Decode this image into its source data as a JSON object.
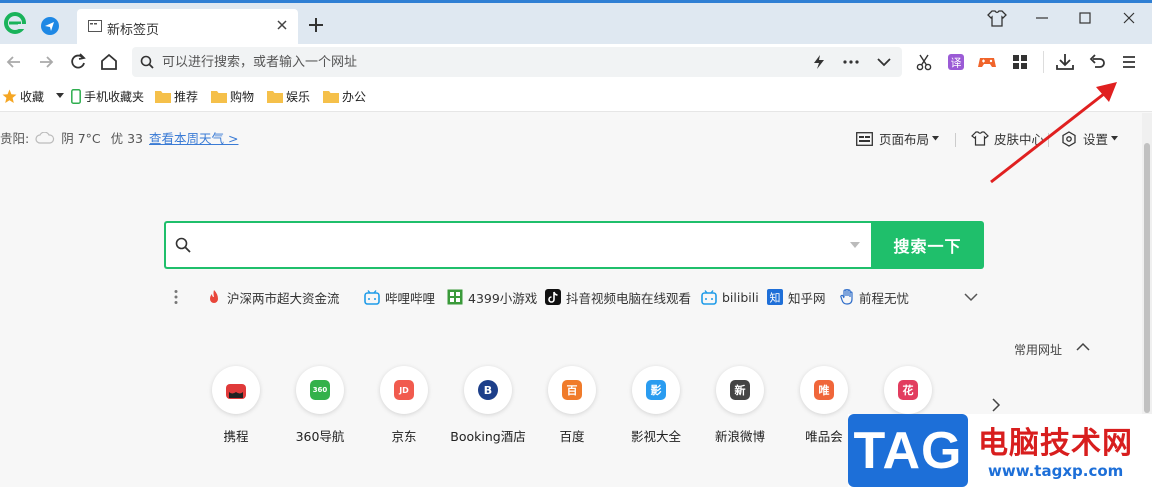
{
  "browser": {
    "tab_title": "新标签页",
    "address_placeholder": "可以进行搜索，或者输入一个网址"
  },
  "bookmarks": [
    {
      "label": "收藏",
      "icon": "star-icon"
    },
    {
      "label": "手机收藏夹",
      "icon": "phone-icon"
    },
    {
      "label": "推荐",
      "icon": "folder-icon"
    },
    {
      "label": "购物",
      "icon": "folder-icon"
    },
    {
      "label": "娱乐",
      "icon": "folder-icon"
    },
    {
      "label": "办公",
      "icon": "folder-icon"
    }
  ],
  "weather": {
    "city": "贵阳:",
    "condition": "阴 7°C",
    "aqi": "优 33",
    "link": "查看本周天气 >"
  },
  "top_actions": {
    "layout": "页面布局",
    "skin": "皮肤中心",
    "settings": "设置"
  },
  "search": {
    "placeholder": "",
    "button": "搜索一下"
  },
  "hot_links": [
    {
      "label": "沪深两市超大资金流",
      "icon": "fire-icon",
      "color": "#e8463a"
    },
    {
      "label": "哔哩哔哩",
      "icon": "bilibili-icon",
      "color": "#1e9be8"
    },
    {
      "label": "4399小游戏",
      "icon": "game-icon",
      "color": "#3a9a3a"
    },
    {
      "label": "抖音视频电脑在线观看",
      "icon": "douyin-icon",
      "color": "#111111"
    },
    {
      "label": "bilibili",
      "icon": "bilibili-icon",
      "color": "#1e9be8"
    },
    {
      "label": "知乎网",
      "icon": "zhihu-icon",
      "color": "#1e6fd8"
    },
    {
      "label": "前程无忧",
      "icon": "hand-icon",
      "color": "#2d6cc9"
    }
  ],
  "common_sites_label": "常用网址",
  "sites": [
    {
      "label": "携程",
      "glyph": "",
      "color": "#e03a3a"
    },
    {
      "label": "360导航",
      "glyph": "360",
      "color": "#33b14a"
    },
    {
      "label": "京东",
      "glyph": "JD",
      "color": "#f15b4e"
    },
    {
      "label": "Booking酒店",
      "glyph": "B",
      "color": "#1d3f8a"
    },
    {
      "label": "百度",
      "glyph": "百",
      "color": "#f07b2a"
    },
    {
      "label": "影视大全",
      "glyph": "影",
      "color": "#2a9cf0"
    },
    {
      "label": "新浪微博",
      "glyph": "新",
      "color": "#444444"
    },
    {
      "label": "唯品会",
      "glyph": "唯",
      "color": "#f0663a"
    },
    {
      "label": "花",
      "glyph": "花",
      "color": "#e23d5f"
    }
  ],
  "watermark": {
    "tag": "TAG",
    "title": "电脑技术网",
    "url": "www.tagxp.com"
  },
  "colors": {
    "accent_green": "#1fbf6b",
    "link_blue": "#3a7bd5",
    "annotation_red": "#e02020"
  }
}
